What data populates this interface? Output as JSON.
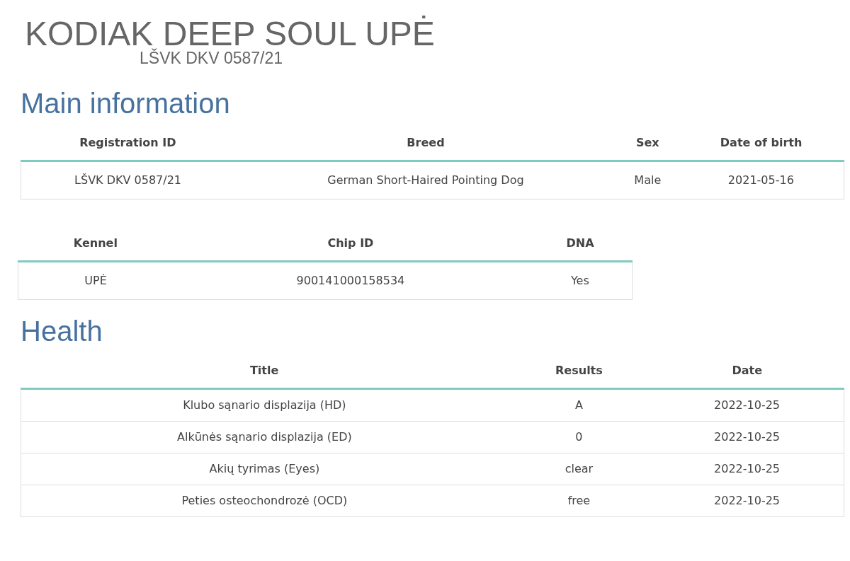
{
  "title": "KODIAK DEEP SOUL UPĖ",
  "subtitle": "LŠVK DKV 0587/21",
  "sections": [
    {
      "heading": "Main information",
      "tables": [
        {
          "columns": [
            "Registration ID",
            "Breed",
            "Sex",
            "Date of birth"
          ],
          "rows": [
            [
              "LŠVK DKV 0587/21",
              "German Short-Haired Pointing Dog",
              "Male",
              "2021-05-16"
            ]
          ]
        },
        {
          "columns": [
            "Kennel",
            "Chip ID",
            "DNA"
          ],
          "rows": [
            [
              "UPĖ",
              "900141000158534",
              "Yes"
            ]
          ]
        }
      ]
    },
    {
      "heading": "Health",
      "tables": [
        {
          "columns": [
            "Title",
            "Results",
            "Date"
          ],
          "rows": [
            [
              "Klubo sąnario displazija (HD)",
              "A",
              "2022-10-25"
            ],
            [
              "Alkūnės sąnario displazija (ED)",
              "0",
              "2022-10-25"
            ],
            [
              "Akių tyrimas (Eyes)",
              "clear",
              "2022-10-25"
            ],
            [
              "Peties osteochondrozė (OCD)",
              "free",
              "2022-10-25"
            ]
          ]
        }
      ]
    }
  ]
}
